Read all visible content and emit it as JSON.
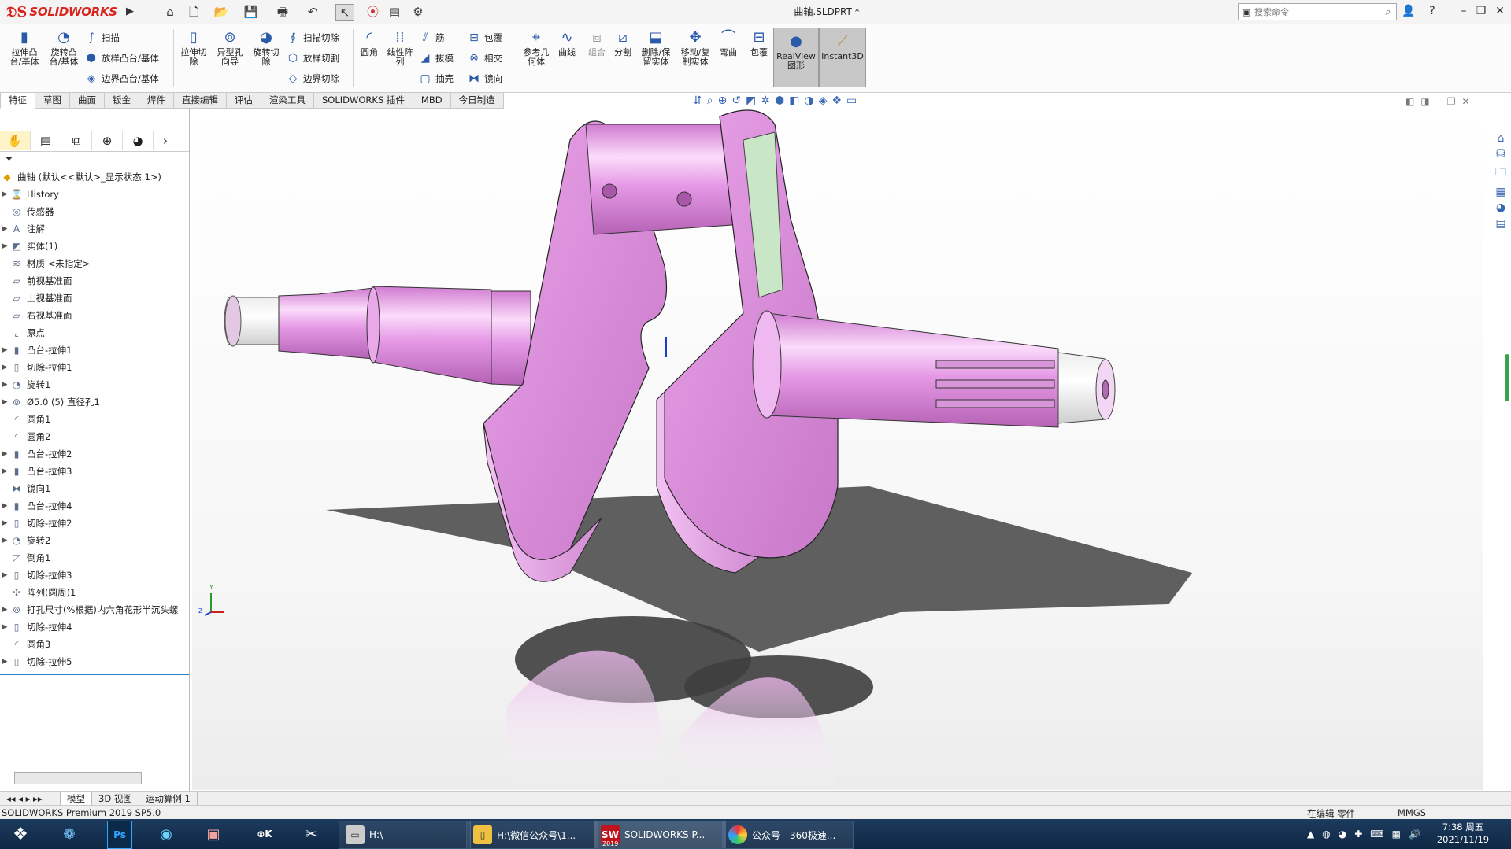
{
  "app": {
    "logo": "SOLIDWORKS",
    "doc_title": "曲轴.SLDPRT *",
    "search_placeholder": "搜索命令"
  },
  "quick_access": [
    "home-icon",
    "new-icon",
    "open-icon",
    "save-icon",
    "print-icon",
    "undo-icon",
    "select-icon",
    "traffic-light-icon",
    "file-props-icon",
    "options-icon"
  ],
  "ribbon": {
    "boss_extrude": "拉伸凸\n台/基体",
    "revolve_boss": "旋转凸\n台/基体",
    "sweep": "扫描",
    "loft_boss": "放样凸台/基体",
    "boundary_boss": "边界凸台/基体",
    "extruded_cut": "拉伸切\n除",
    "hole_wizard": "异型孔\n向导",
    "revolved_cut": "旋转切\n除",
    "swept_cut": "扫描切除",
    "lofted_cut": "放样切割",
    "boundary_cut": "边界切除",
    "fillet": "圆角",
    "linear_pattern": "线性阵\n列",
    "rib": "筋",
    "draft": "拔模",
    "shell": "抽壳",
    "wrap": "包覆",
    "intersect": "相交",
    "mirror": "镜向",
    "ref_geometry": "参考几\n何体",
    "curves": "曲线",
    "combine": "组合",
    "split": "分割",
    "delete_keep": "删除/保\n留实体",
    "move_copy": "移动/复\n制实体",
    "flex": "弯曲",
    "wrap2": "包覆",
    "realview": "RealView\n图形",
    "instant3d": "Instant3D"
  },
  "tabs": [
    "特征",
    "草图",
    "曲面",
    "钣金",
    "焊件",
    "直接编辑",
    "评估",
    "渲染工具",
    "SOLIDWORKS 插件",
    "MBD",
    "今日制造"
  ],
  "feature_tree": {
    "root": "曲轴  (默认<<默认>_显示状态 1>)",
    "items": [
      {
        "label": "History",
        "icon": "history-icon",
        "expand": true
      },
      {
        "label": "传感器",
        "icon": "sensor-icon",
        "expand": false
      },
      {
        "label": "注解",
        "icon": "annotation-icon",
        "expand": true
      },
      {
        "label": "实体(1)",
        "icon": "solid-body-icon",
        "expand": true
      },
      {
        "label": "材质 <未指定>",
        "icon": "material-icon",
        "expand": false
      },
      {
        "label": "前视基准面",
        "icon": "plane-icon",
        "expand": false
      },
      {
        "label": "上视基准面",
        "icon": "plane-icon",
        "expand": false
      },
      {
        "label": "右视基准面",
        "icon": "plane-icon",
        "expand": false
      },
      {
        "label": "原点",
        "icon": "origin-icon",
        "expand": false
      },
      {
        "label": "凸台-拉伸1",
        "icon": "extrude-icon",
        "expand": true
      },
      {
        "label": "切除-拉伸1",
        "icon": "cut-icon",
        "expand": true
      },
      {
        "label": "旋转1",
        "icon": "revolve-icon",
        "expand": true
      },
      {
        "label": "Ø5.0 (5) 直径孔1",
        "icon": "hole-icon",
        "expand": true
      },
      {
        "label": "圆角1",
        "icon": "fillet-icon",
        "expand": false
      },
      {
        "label": "圆角2",
        "icon": "fillet-icon",
        "expand": false
      },
      {
        "label": "凸台-拉伸2",
        "icon": "extrude-icon",
        "expand": true
      },
      {
        "label": "凸台-拉伸3",
        "icon": "extrude-icon",
        "expand": true
      },
      {
        "label": "镜向1",
        "icon": "mirror-icon",
        "expand": false
      },
      {
        "label": "凸台-拉伸4",
        "icon": "extrude-icon",
        "expand": true
      },
      {
        "label": "切除-拉伸2",
        "icon": "cut-icon",
        "expand": true
      },
      {
        "label": "旋转2",
        "icon": "revolve-icon",
        "expand": true
      },
      {
        "label": "倒角1",
        "icon": "chamfer-icon",
        "expand": false
      },
      {
        "label": "切除-拉伸3",
        "icon": "cut-icon",
        "expand": true
      },
      {
        "label": "阵列(圆周)1",
        "icon": "circular-pattern-icon",
        "expand": false
      },
      {
        "label": "打孔尺寸(%根据)内六角花形半沉头螺",
        "icon": "hole-icon",
        "expand": true
      },
      {
        "label": "切除-拉伸4",
        "icon": "cut-icon",
        "expand": true
      },
      {
        "label": "圆角3",
        "icon": "fillet-icon",
        "expand": false
      },
      {
        "label": "切除-拉伸5",
        "icon": "cut-icon",
        "expand": true
      }
    ]
  },
  "bottom_tabs": [
    "模型",
    "3D 视图",
    "运动算例 1"
  ],
  "status": {
    "left": "SOLIDWORKS Premium 2019 SP5.0",
    "mode": "在编辑 零件",
    "units": "MMGS"
  },
  "triad": {
    "y": "Y",
    "z": "Z"
  },
  "taskbar": {
    "explorer_h": "H:\\",
    "wechat_folder": "H:\\微信公众号\\1...",
    "solidworks": "SOLIDWORKS P...",
    "solidworks_badge": "2019",
    "browser": "公众号 - 360极速...",
    "time": "7:38 周五",
    "date": "2021/11/19"
  },
  "colors": {
    "part_pink": "#e79ae6",
    "brand_red": "#d9231d",
    "taskbar": "#14304f"
  }
}
